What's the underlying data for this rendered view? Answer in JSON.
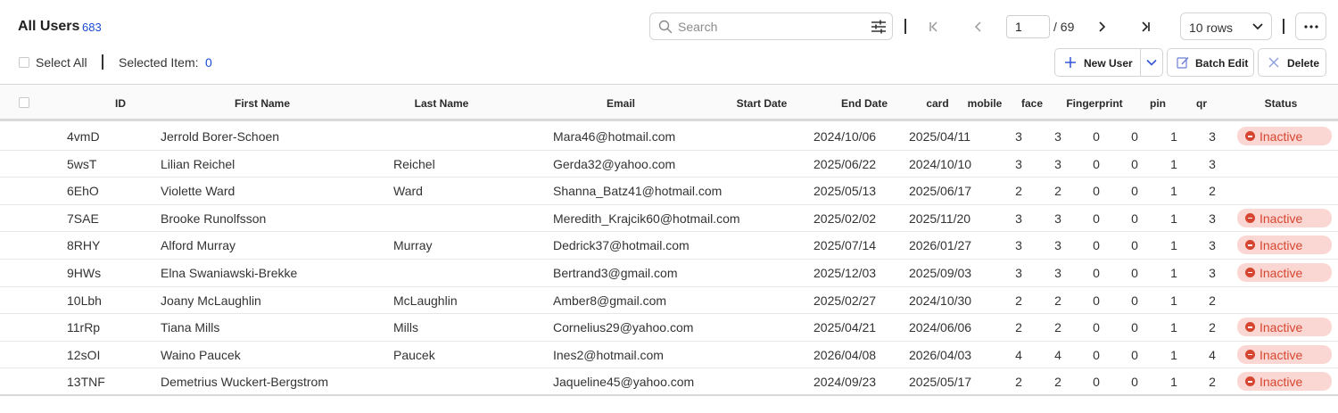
{
  "header": {
    "title": "All Users",
    "count": "683"
  },
  "search": {
    "placeholder": "Search",
    "value": ""
  },
  "pagination": {
    "current_page": "1",
    "total_label": "/ 69"
  },
  "rows_select": {
    "selected": "10 rows"
  },
  "selection": {
    "select_all_label": "Select All",
    "selected_item_label": "Selected Item:",
    "selected_item_count": "0"
  },
  "actions": {
    "new_user_label": "New User",
    "batch_edit_label": "Batch Edit",
    "delete_label": "Delete"
  },
  "icons": {
    "search": "search-icon",
    "filter": "filter-sliders-icon",
    "first_page": "first-page-icon",
    "prev_page": "chevron-left-icon",
    "next_page": "chevron-right-icon",
    "last_page": "last-page-icon",
    "dropdown": "chevron-down-icon",
    "more": "more-horizontal-icon",
    "new_user": "plus-icon",
    "batch_edit": "edit-icon",
    "delete": "close-icon",
    "inactive": "minus-circle-icon"
  },
  "colors": {
    "accent": "#1a4bd8",
    "inactive_bg": "#fbd7d3",
    "inactive_fg": "#d6452f"
  },
  "table": {
    "columns": {
      "id": "ID",
      "first_name": "First Name",
      "last_name": "Last Name",
      "email": "Email",
      "start_date": "Start Date",
      "end_date": "End Date",
      "card": "card",
      "mobile": "mobile",
      "face": "face",
      "fingerprint": "Fingerprint",
      "pin": "pin",
      "qr": "qr",
      "status": "Status"
    },
    "rows": [
      {
        "id": "4vmD",
        "first_name": "Jerrold Borer-Schoen",
        "last_name": "",
        "email": "Mara46@hotmail.com",
        "start_date": "2024/10/06",
        "end_date": "2025/04/11",
        "card": "3",
        "mobile": "3",
        "face": "0",
        "fingerprint": "0",
        "pin": "1",
        "qr": "3",
        "status": "Inactive"
      },
      {
        "id": "5wsT",
        "first_name": "Lilian Reichel",
        "last_name": "Reichel",
        "email": "Gerda32@yahoo.com",
        "start_date": "2025/06/22",
        "end_date": "2024/10/10",
        "card": "3",
        "mobile": "3",
        "face": "0",
        "fingerprint": "0",
        "pin": "1",
        "qr": "3",
        "status": ""
      },
      {
        "id": "6EhO",
        "first_name": "Violette Ward",
        "last_name": "Ward",
        "email": "Shanna_Batz41@hotmail.com",
        "start_date": "2025/05/13",
        "end_date": "2025/06/17",
        "card": "2",
        "mobile": "2",
        "face": "0",
        "fingerprint": "0",
        "pin": "1",
        "qr": "2",
        "status": ""
      },
      {
        "id": "7SAE",
        "first_name": "Brooke Runolfsson",
        "last_name": "",
        "email": "Meredith_Krajcik60@hotmail.com",
        "start_date": "2025/02/02",
        "end_date": "2025/11/20",
        "card": "3",
        "mobile": "3",
        "face": "0",
        "fingerprint": "0",
        "pin": "1",
        "qr": "3",
        "status": "Inactive"
      },
      {
        "id": "8RHY",
        "first_name": "Alford Murray",
        "last_name": "Murray",
        "email": "Dedrick37@hotmail.com",
        "start_date": "2025/07/14",
        "end_date": "2026/01/27",
        "card": "3",
        "mobile": "3",
        "face": "0",
        "fingerprint": "0",
        "pin": "1",
        "qr": "3",
        "status": "Inactive"
      },
      {
        "id": "9HWs",
        "first_name": "Elna Swaniawski-Brekke",
        "last_name": "",
        "email": "Bertrand3@gmail.com",
        "start_date": "2025/12/03",
        "end_date": "2025/09/03",
        "card": "3",
        "mobile": "3",
        "face": "0",
        "fingerprint": "0",
        "pin": "1",
        "qr": "3",
        "status": "Inactive"
      },
      {
        "id": "10Lbh",
        "first_name": "Joany McLaughlin",
        "last_name": "McLaughlin",
        "email": "Amber8@gmail.com",
        "start_date": "2025/02/27",
        "end_date": "2024/10/30",
        "card": "2",
        "mobile": "2",
        "face": "0",
        "fingerprint": "0",
        "pin": "1",
        "qr": "2",
        "status": ""
      },
      {
        "id": "11rRp",
        "first_name": "Tiana Mills",
        "last_name": "Mills",
        "email": "Cornelius29@yahoo.com",
        "start_date": "2025/04/21",
        "end_date": "2024/06/06",
        "card": "2",
        "mobile": "2",
        "face": "0",
        "fingerprint": "0",
        "pin": "1",
        "qr": "2",
        "status": "Inactive"
      },
      {
        "id": "12sOI",
        "first_name": "Waino Paucek",
        "last_name": "Paucek",
        "email": "Ines2@hotmail.com",
        "start_date": "2026/04/08",
        "end_date": "2026/04/03",
        "card": "4",
        "mobile": "4",
        "face": "0",
        "fingerprint": "0",
        "pin": "1",
        "qr": "4",
        "status": "Inactive"
      },
      {
        "id": "13TNF",
        "first_name": "Demetrius Wuckert-Bergstrom",
        "last_name": "",
        "email": "Jaqueline45@yahoo.com",
        "start_date": "2024/09/23",
        "end_date": "2025/05/17",
        "card": "2",
        "mobile": "2",
        "face": "0",
        "fingerprint": "0",
        "pin": "1",
        "qr": "2",
        "status": "Inactive"
      }
    ]
  }
}
